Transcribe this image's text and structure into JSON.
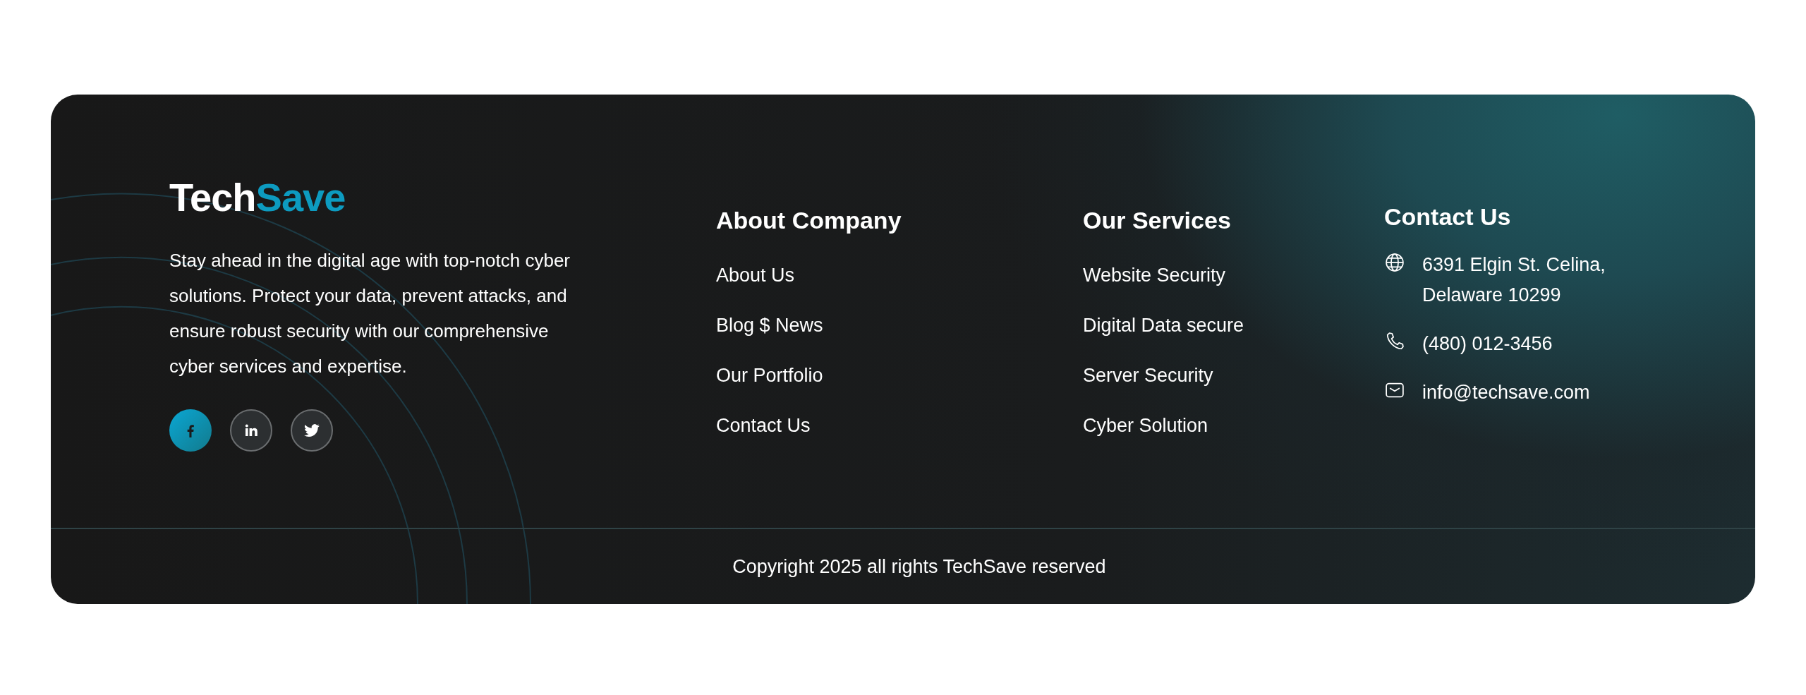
{
  "brand": {
    "first": "Tech",
    "second": "Save"
  },
  "description": "Stay ahead in the digital age with top-notch cyber solutions. Protect your data, prevent attacks, and ensure robust security with our comprehensive cyber services and expertise.",
  "social": [
    {
      "kind": "facebook",
      "selected": true
    },
    {
      "kind": "linkedin",
      "selected": false
    },
    {
      "kind": "twitter",
      "selected": false
    }
  ],
  "columns": [
    {
      "title": "About Company",
      "links": [
        "About Us",
        "Blog $ News",
        "Our Portfolio",
        "Contact Us"
      ]
    },
    {
      "title": "Our Services",
      "links": [
        "Website Security",
        "Digital Data secure",
        "Server Security",
        "Cyber Solution"
      ]
    }
  ],
  "contact": {
    "title": "Contact Us",
    "items": [
      {
        "kind": "address",
        "lines": [
          "6391 Elgin St. Celina,",
          "Delaware 10299"
        ]
      },
      {
        "kind": "phone",
        "lines": [
          "(480) 012-3456"
        ]
      },
      {
        "kind": "email",
        "lines": [
          "info@techsave.com"
        ]
      }
    ]
  },
  "copyright": "Copyright 2025 all rights TechSave reserved"
}
